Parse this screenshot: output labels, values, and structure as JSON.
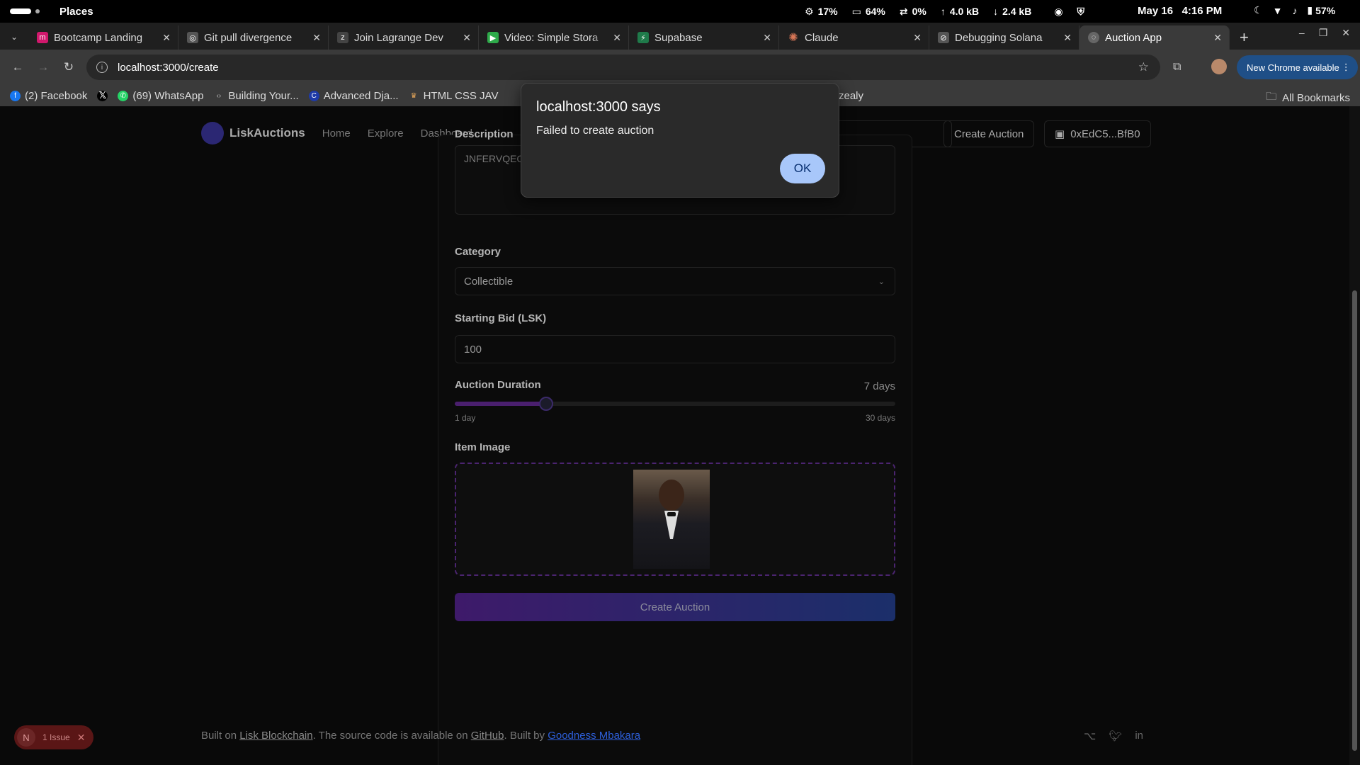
{
  "system": {
    "places": "Places",
    "cpu": "17%",
    "memory": "64%",
    "swap": "0%",
    "upload": "4.0 kB",
    "download": "2.4 kB",
    "date": "May 16",
    "time": "4:16 PM",
    "battery": "57%"
  },
  "tabs": [
    {
      "label": "Bootcamp Landing",
      "color": "#d0186c"
    },
    {
      "label": "Git pull divergence",
      "color": "#555555"
    },
    {
      "label": "Join Lagrange Dev",
      "color": "#444444"
    },
    {
      "label": "Video: Simple Stora",
      "color": "#2eaa4a"
    },
    {
      "label": "Supabase",
      "color": "#1f7a4a"
    },
    {
      "label": "Claude",
      "color": "#d97757"
    },
    {
      "label": "Debugging Solana",
      "color": "#555555"
    },
    {
      "label": "Auction App",
      "color": "#666666",
      "active": true
    }
  ],
  "toolbar": {
    "url": "localhost:3000/create",
    "new_chrome": "New Chrome available"
  },
  "bookmarks": [
    {
      "label": "(2) Facebook",
      "color": "#1877f2",
      "glyph": "f"
    },
    {
      "label": "",
      "color": "#000000",
      "glyph": "X"
    },
    {
      "label": "(69) WhatsApp",
      "color": "#25d366",
      "glyph": "w"
    },
    {
      "label": "Building Your...",
      "color": "#555555",
      "glyph": "<>"
    },
    {
      "label": "Advanced Dja...",
      "color": "#1e3aa8",
      "glyph": "C"
    },
    {
      "label": "HTML CSS JAV",
      "color": "#8a5a2a",
      "glyph": "H"
    }
  ],
  "bookmark_partial": "zealy",
  "all_bookmarks": "All Bookmarks",
  "nav": {
    "brand": "LiskAuctions",
    "home": "Home",
    "explore": "Explore",
    "dashboard": "Dashboard",
    "create": "Create Auction",
    "wallet": "0xEdC5...BfB0"
  },
  "form": {
    "description_label": "Description",
    "description_value": "JNFERVQEC",
    "category_label": "Category",
    "category_value": "Collectible",
    "bid_label": "Starting Bid (LSK)",
    "bid_value": "100",
    "duration_label": "Auction Duration",
    "duration_value": "7 days",
    "duration_min": "1 day",
    "duration_max": "30 days",
    "duration_fraction": 0.207,
    "image_label": "Item Image",
    "submit": "Create Auction"
  },
  "footer": {
    "built_on": "Built on ",
    "lisk": "Lisk Blockchain",
    "mid": ". The source code is available on ",
    "github": "GitHub",
    "built_by": ". Built by ",
    "author": "Goodness Mbakara"
  },
  "issue": {
    "badge": "N",
    "label": "1 Issue"
  },
  "dialog": {
    "title": "localhost:3000 says",
    "message": "Failed to create auction",
    "ok": "OK"
  }
}
